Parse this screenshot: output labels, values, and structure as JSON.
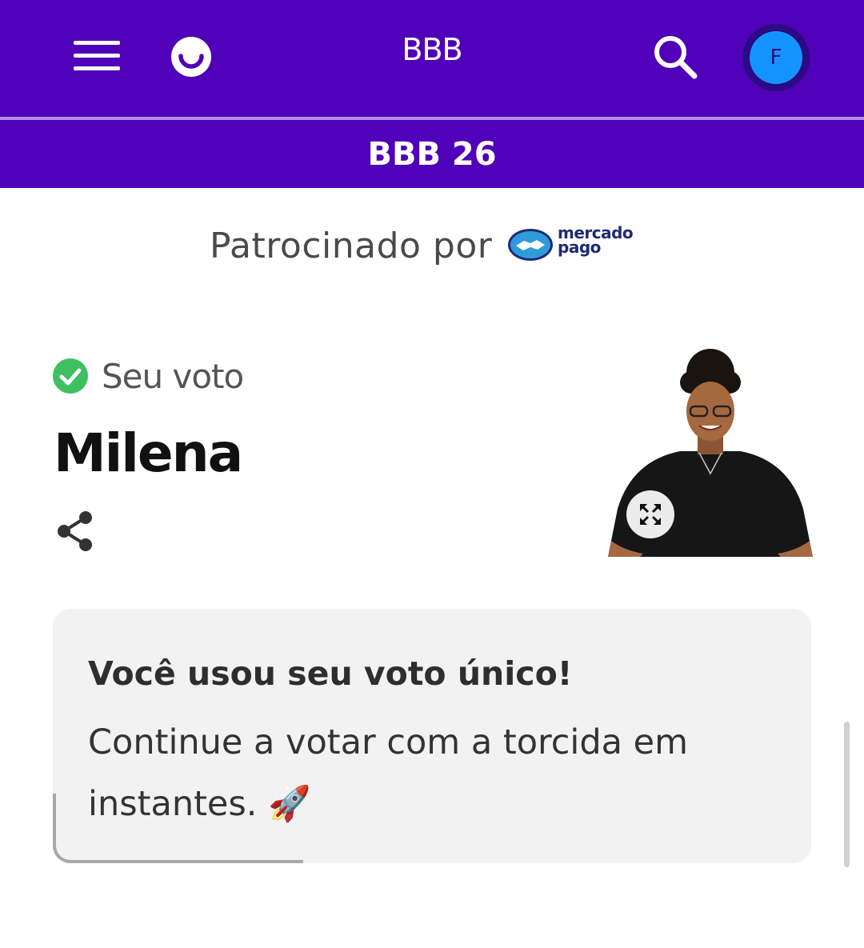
{
  "header": {
    "title": "BBB",
    "subtitle": "BBB 26",
    "avatar_initial": "F",
    "colors": {
      "brand": "#5000b8",
      "avatar": "#1493ff"
    }
  },
  "sponsor": {
    "label": "Patrocinado por",
    "logo_text_line1": "mercado",
    "logo_text_line2": "pago"
  },
  "vote": {
    "status_label": "Seu voto",
    "candidate": "Milena"
  },
  "card": {
    "title": "Você usou seu voto único!",
    "body": "Continue a votar com a torcida em instantes. 🚀"
  },
  "icons": [
    "menu-icon",
    "logo-icon",
    "search-icon",
    "check-icon",
    "share-icon",
    "expand-icon",
    "rocket-icon"
  ]
}
